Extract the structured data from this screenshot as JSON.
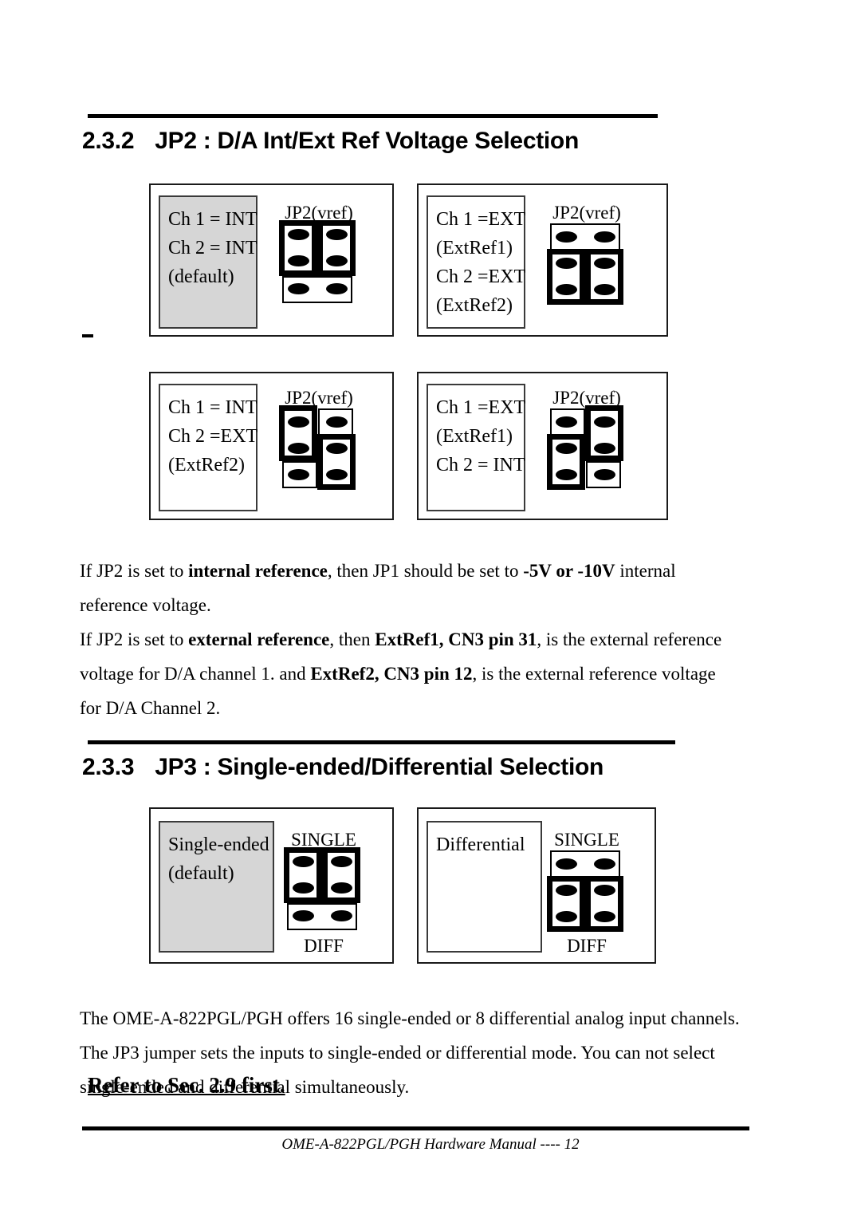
{
  "document": {
    "footer_text": "OME-A-822PGL/PGH Hardware Manual   ---- 12"
  },
  "sections": [
    {
      "number": "2.3.2",
      "title": "JP2 : D/A Int/Ext Ref Voltage Selection",
      "diagrams": [
        {
          "lines": [
            "Ch 1 = INT",
            "Ch 2 = INT",
            "(default)"
          ],
          "shaded": true,
          "jumper_label_top": "JP2(vref)",
          "jumper_label_bottom": "",
          "left_column_jumper_rows": "1-2",
          "right_column_jumper_rows": "1-2"
        },
        {
          "lines": [
            "Ch 1 =EXT",
            "(ExtRef1)",
            "Ch 2 =EXT",
            "(ExtRef2)"
          ],
          "shaded": false,
          "jumper_label_top": "JP2(vref)",
          "jumper_label_bottom": "",
          "left_column_jumper_rows": "2-3",
          "right_column_jumper_rows": "2-3"
        },
        {
          "lines": [
            "Ch 1 = INT",
            "Ch 2 =EXT",
            "(ExtRef2)"
          ],
          "shaded": false,
          "jumper_label_top": "JP2(vref)",
          "jumper_label_bottom": "",
          "left_column_jumper_rows": "1-2",
          "right_column_jumper_rows": "2-3"
        },
        {
          "lines": [
            "Ch 1 =EXT",
            "(ExtRef1)",
            "Ch 2 = INT"
          ],
          "shaded": false,
          "jumper_label_top": "JP2(vref)",
          "jumper_label_bottom": "",
          "left_column_jumper_rows": "2-3",
          "right_column_jumper_rows": "1-2"
        }
      ],
      "paragraphs": [
        {
          "runs": [
            {
              "t": "If JP2 is set to ",
              "b": false
            },
            {
              "t": "internal reference",
              "b": true
            },
            {
              "t": ", then JP1 should be set to ",
              "b": false
            },
            {
              "t": "-5V or -10V",
              "b": true
            },
            {
              "t": " internal reference voltage.",
              "b": false
            }
          ]
        },
        {
          "runs": [
            {
              "t": "If JP2 is set to ",
              "b": false
            },
            {
              "t": "external reference",
              "b": true
            },
            {
              "t": ", then ",
              "b": false
            },
            {
              "t": "ExtRef1, CN3 pin 31",
              "b": true
            },
            {
              "t": ", is the external reference voltage for D/A channel 1. and ",
              "b": false
            },
            {
              "t": "ExtRef2, CN3 pin 12",
              "b": true
            },
            {
              "t": ", is the external reference voltage for D/A Channel 2.",
              "b": false
            }
          ]
        }
      ]
    },
    {
      "number": "2.3.3",
      "title": "JP3 : Single-ended/Differential Selection",
      "diagrams": [
        {
          "lines": [
            "Single-ended",
            "(default)"
          ],
          "shaded": true,
          "jumper_label_top": "SINGLE",
          "jumper_label_bottom": "DIFF",
          "left_column_jumper_rows": "1-2",
          "right_column_jumper_rows": "1-2"
        },
        {
          "lines": [
            "Differential"
          ],
          "shaded": false,
          "jumper_label_top": "SINGLE",
          "jumper_label_bottom": "DIFF",
          "left_column_jumper_rows": "2-3",
          "right_column_jumper_rows": "2-3"
        }
      ],
      "paragraphs": [
        {
          "runs": [
            {
              "t": "The OME-A-822PGL/PGH offers 16 single-ended or 8 differential analog input channels. The JP3 jumper sets the inputs to single-ended or differential mode. You can not select single-ended and differential simultaneously.",
              "b": false
            }
          ]
        }
      ],
      "note": "Refer to Sec. 2.9 first."
    }
  ]
}
